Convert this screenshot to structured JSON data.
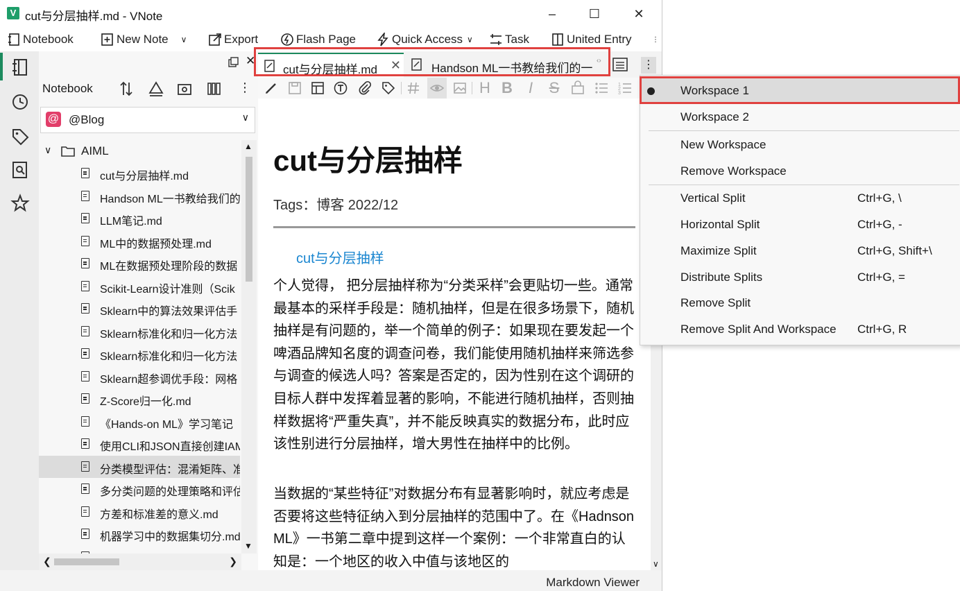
{
  "window": {
    "title": "cut与分层抽样.md - VNote",
    "app_icon_letter": "V"
  },
  "toolbar": {
    "notebook": "Notebook",
    "new_note": "New Note",
    "export": "Export",
    "flash_page": "Flash Page",
    "quick_access": "Quick Access",
    "task": "Task",
    "united_entry": "United Entry"
  },
  "notebook_pane": {
    "header_label": "Notebook",
    "selected_notebook": "@Blog",
    "notebook_icon_glyph": "@",
    "folder": "AIML",
    "items": [
      "cut与分层抽样.md",
      "Handson ML一书教给我们的",
      "LLM笔记.md",
      "ML中的数据预处理.md",
      "ML在数据预处理阶段的数据",
      "Scikit-Learn设计准则（Scik",
      "Sklearn中的算法效果评估手",
      "Sklearn标准化和归一化方法",
      "Sklearn标准化和归一化方法",
      "Sklearn超参调优手段：网格",
      "Z-Score归一化.md",
      "《Hands-on ML》学习笔记",
      "使用CLI和JSON直接创建IAM",
      "分类模型评估：混淆矩阵、准",
      "多分类问题的处理策略和评估",
      "方差和标准差的意义.md",
      "机器学习中的数据集切分.md",
      "机器学习笔记.md"
    ],
    "selected_index": 13
  },
  "tabs": [
    {
      "label": "cut与分层抽样.md",
      "active": true
    },
    {
      "label": "Handson ML一书教给我们的一",
      "active": false
    }
  ],
  "document": {
    "heading": "cut与分层抽样",
    "tags": "Tags：博客 2022/12",
    "toc_link": "cut与分层抽样",
    "paragraph1": "个人觉得， 把分层抽样称为“分类采样”会更贴切一些。通常最基本的采样手段是：随机抽样，但是在很多场景下，随机抽样是有问题的，举一个简单的例子：如果现在要发起一个啤酒品牌知名度的调查问卷，我们能使用随机抽样来筛选参与调查的候选人吗？答案是否定的，因为性别在这个调研的目标人群中发挥着显著的影响，不能进行随机抽样，否则抽样数据将“严重失真”，并不能反映真实的数据分布，此时应该性别进行分层抽样，增大男性在抽样中的比例。",
    "paragraph2": "当数据的“某些特征”对数据分布有显著影响时，就应考虑是否要将这些特征纳入到分层抽样的范围中了。在《Hadnson ML》一书第二章中提到这样一个案例：一个非常直白的认知是：一个地区的收入中值与该地区的"
  },
  "status": {
    "viewer": "Markdown Viewer"
  },
  "menu": {
    "items": [
      {
        "label": "Workspace 1",
        "shortcut": "",
        "checked": true,
        "hover": true
      },
      {
        "label": "Workspace 2",
        "shortcut": "",
        "checked": false
      },
      {
        "label": "New Workspace",
        "shortcut": "",
        "checked": false
      },
      {
        "label": "Remove Workspace",
        "shortcut": "",
        "checked": false
      },
      {
        "label": "Vertical Split",
        "shortcut": "Ctrl+G, \\",
        "checked": false
      },
      {
        "label": "Horizontal Split",
        "shortcut": "Ctrl+G, -",
        "checked": false
      },
      {
        "label": "Maximize Split",
        "shortcut": "Ctrl+G, Shift+\\",
        "checked": false
      },
      {
        "label": "Distribute Splits",
        "shortcut": "Ctrl+G, =",
        "checked": false
      },
      {
        "label": "Remove Split",
        "shortcut": "",
        "checked": false
      },
      {
        "label": "Remove Split And Workspace",
        "shortcut": "Ctrl+G, R",
        "checked": false
      }
    ]
  },
  "colors": {
    "accent": "#1c8a5e",
    "highlight_box": "#e0413f",
    "link": "#1a86d0"
  }
}
